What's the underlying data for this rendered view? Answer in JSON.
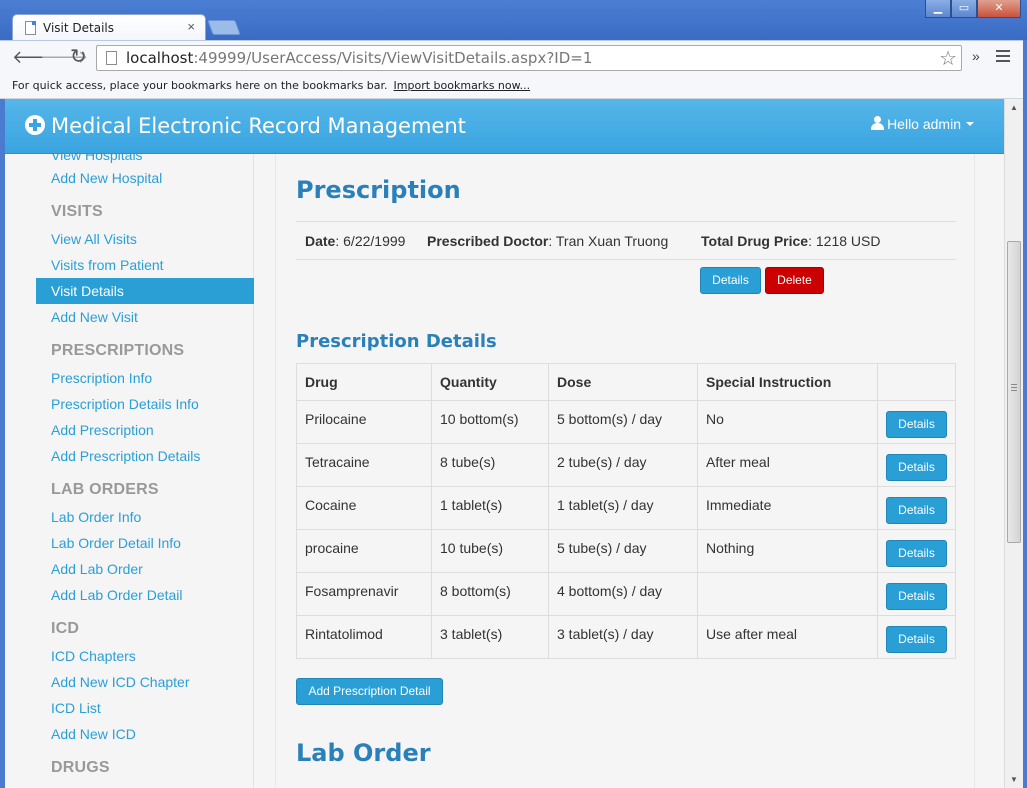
{
  "browser": {
    "tab_title": "Visit Details",
    "tab_close": "×",
    "url_host": "localhost",
    "url_rest": ":49999/UserAccess/Visits/ViewVisitDetails.aspx?ID=1",
    "bookmarks_text": "For quick access, place your bookmarks here on the bookmarks bar.",
    "bookmarks_link": "Import bookmarks now...",
    "back": "🡐",
    "forward": "🡒",
    "reload": "↻",
    "star": "☆",
    "overflow": "»",
    "win_min": "▁",
    "win_max": "▭",
    "win_close": "✕",
    "scroll_up": "▲",
    "scroll_down": "▼"
  },
  "app": {
    "brand": "Medical Electronic Record Management",
    "user": "Hello admin"
  },
  "sidebar": {
    "partial_item": "View Hospitals",
    "add_hospital": "Add New Hospital",
    "visits_header": "VISITS",
    "visits": [
      "View All Visits",
      "Visits from Patient",
      "Visit Details",
      "Add New Visit"
    ],
    "prescriptions_header": "PRESCRIPTIONS",
    "prescriptions": [
      "Prescription Info",
      "Prescription Details Info",
      "Add Prescription",
      "Add Prescription Details"
    ],
    "lab_header": "LAB ORDERS",
    "lab": [
      "Lab Order Info",
      "Lab Order Detail Info",
      "Add Lab Order",
      "Add Lab Order Detail"
    ],
    "icd_header": "ICD",
    "icd": [
      "ICD Chapters",
      "Add New ICD Chapter",
      "ICD List",
      "Add New ICD"
    ],
    "drugs_header": "DRUGS"
  },
  "prescription": {
    "title": "Prescription",
    "date_label": "Date",
    "date_value": ": 6/22/1999",
    "doctor_label": "Prescribed Doctor",
    "doctor_value": ": Tran Xuan Truong",
    "price_label": "Total Drug Price",
    "price_value": ": 1218 USD",
    "details_btn": "Details",
    "delete_btn": "Delete"
  },
  "details": {
    "title": "Prescription Details",
    "columns": [
      "Drug",
      "Quantity",
      "Dose",
      "Special Instruction",
      ""
    ],
    "rows": [
      {
        "drug": "Prilocaine",
        "quantity": "10 bottom(s)",
        "dose": "5 bottom(s) / day",
        "instruction": "No",
        "action": "Details"
      },
      {
        "drug": "Tetracaine",
        "quantity": "8 tube(s)",
        "dose": "2 tube(s) / day",
        "instruction": "After meal",
        "action": "Details"
      },
      {
        "drug": "Cocaine",
        "quantity": "1 tablet(s)",
        "dose": "1 tablet(s) / day",
        "instruction": "Immediate",
        "action": "Details"
      },
      {
        "drug": "procaine",
        "quantity": "10 tube(s)",
        "dose": "5 tube(s) / day",
        "instruction": "Nothing",
        "action": "Details"
      },
      {
        "drug": "Fosamprenavir",
        "quantity": "8 bottom(s)",
        "dose": "4 bottom(s) / day",
        "instruction": "",
        "action": "Details"
      },
      {
        "drug": "Rintatolimod",
        "quantity": "3 tablet(s)",
        "dose": "3 tablet(s) / day",
        "instruction": "Use after meal",
        "action": "Details"
      }
    ],
    "add_btn": "Add Prescription Detail"
  },
  "lab_order": {
    "title": "Lab Order"
  }
}
